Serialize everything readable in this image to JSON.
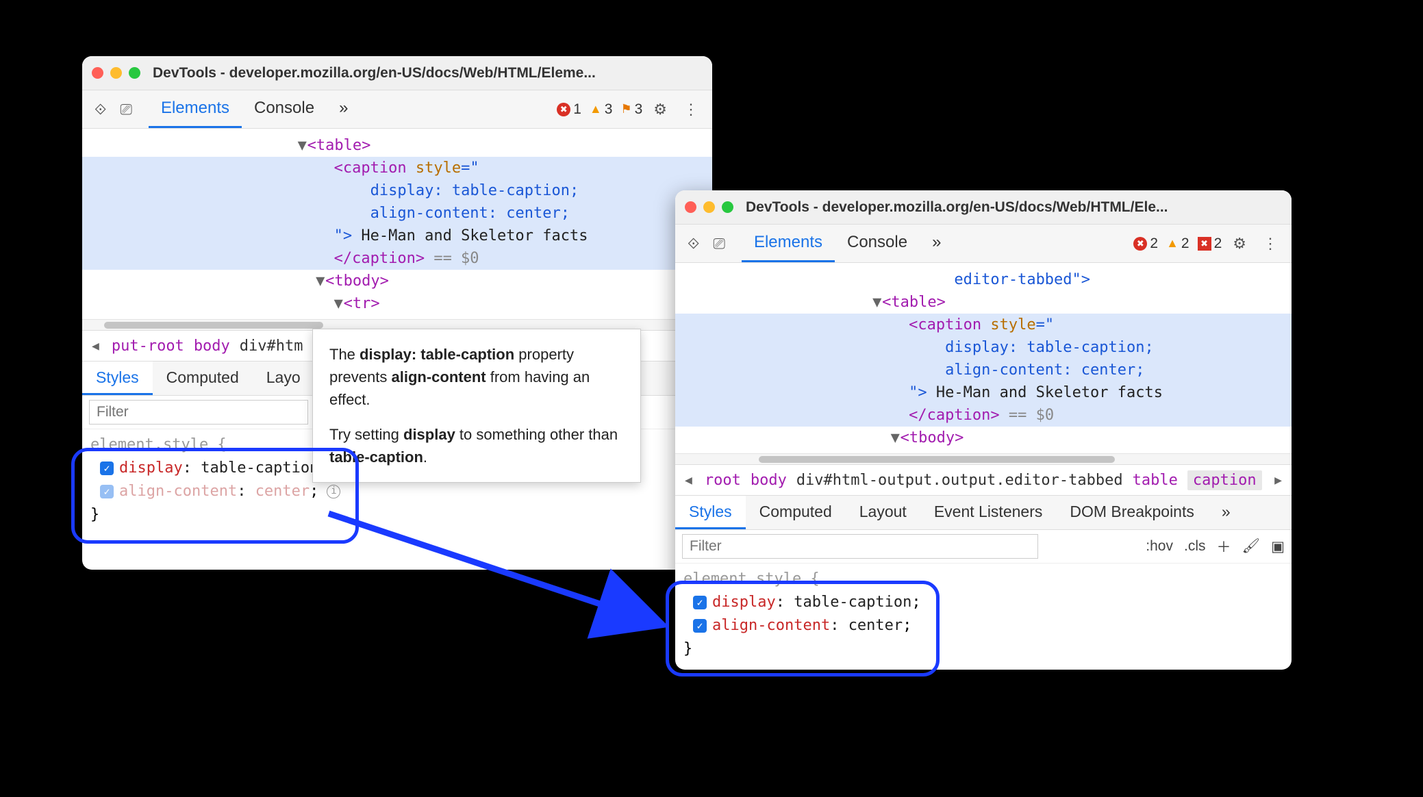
{
  "window1": {
    "title": "DevTools - developer.mozilla.org/en-US/docs/Web/HTML/Eleme...",
    "tabs": {
      "elements": "Elements",
      "console": "Console",
      "more": "»"
    },
    "counts": {
      "errors": "1",
      "warnings": "3",
      "flags": "3"
    },
    "dom": {
      "table_open": "<table>",
      "caption_open": "<caption",
      "style_attr": "style",
      "eq_quote": "=\"",
      "css1_prop": "display",
      "css1_val": "table-caption",
      "css2_prop": "align-content",
      "css2_val": "center",
      "close_quote": "\">",
      "caption_text": "He-Man and Skeletor facts",
      "caption_close": "</caption>",
      "eqz": " == $0",
      "tbody_open": "<tbody>",
      "tr_open": "<tr>"
    },
    "breadcrumb": {
      "i0": "put-root",
      "i1": "body",
      "i2": "div#htm"
    },
    "subtabs": {
      "styles": "Styles",
      "computed": "Computed",
      "layout": "Layo"
    },
    "filter_placeholder": "Filter",
    "styles": {
      "selector": "element.style {",
      "p1_name": "display",
      "p1_val": "table-caption",
      "p2_name": "align-content",
      "p2_val": "center",
      "close": "}"
    },
    "tooltip": {
      "l1a": "The ",
      "l1b": "display: table-caption",
      "l1c": " property prevents ",
      "l1d": "align-content",
      "l1e": " from having an effect.",
      "l2a": "Try setting ",
      "l2b": "display",
      "l2c": " to something other than ",
      "l2d": "table-caption",
      "l2e": "."
    }
  },
  "window2": {
    "title": "DevTools - developer.mozilla.org/en-US/docs/Web/HTML/Ele...",
    "tabs": {
      "elements": "Elements",
      "console": "Console",
      "more": "»"
    },
    "counts": {
      "errors": "2",
      "warnings": "2",
      "flags": "2"
    },
    "dom": {
      "pre_line": "editor-tabbed\">",
      "table_open": "<table>",
      "caption_open": "<caption",
      "style_attr": "style",
      "eq_quote": "=\"",
      "css1_prop": "display",
      "css1_val": "table-caption",
      "css2_prop": "align-content",
      "css2_val": "center",
      "close_quote": "\">",
      "caption_text": "He-Man and Skeletor facts",
      "caption_close": "</caption>",
      "eqz": " == $0",
      "tbody_open": "<tbody>"
    },
    "breadcrumb": {
      "i0": "root",
      "i1": "body",
      "i2": "div#html-output.output.editor-tabbed",
      "i3": "table",
      "i4": "caption"
    },
    "subtabs": {
      "styles": "Styles",
      "computed": "Computed",
      "layout": "Layout",
      "events": "Event Listeners",
      "dombp": "DOM Breakpoints",
      "more": "»"
    },
    "filter_placeholder": "Filter",
    "filter_tools": {
      "hov": ":hov",
      "cls": ".cls"
    },
    "styles": {
      "selector": "element.style {",
      "p1_name": "display",
      "p1_val": "table-caption",
      "p2_name": "align-content",
      "p2_val": "center",
      "close": "}"
    }
  }
}
